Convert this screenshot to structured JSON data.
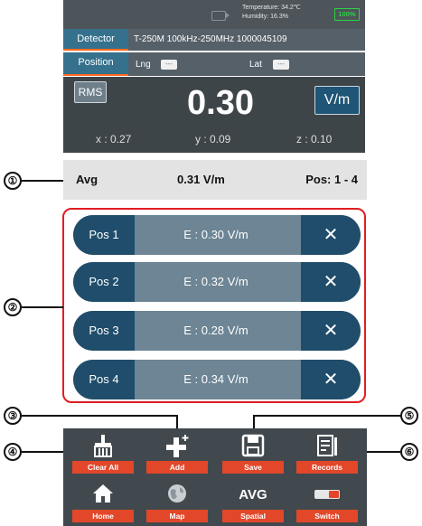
{
  "status": {
    "temperature": "Temperature: 34.2℃",
    "humidity": "Humidity: 16.3%",
    "battery": "100%"
  },
  "detector": {
    "label": "Detector",
    "value": "T-250M 100kHz-250MHz 1000045109"
  },
  "position": {
    "label": "Position",
    "lng_label": "Lng",
    "lng_value": "---",
    "lat_label": "Lat",
    "lat_value": "---"
  },
  "meter": {
    "mode": "RMS",
    "value": "0.30",
    "unit": "V/m",
    "x": "x : 0.27",
    "y": "y : 0.09",
    "z": "z : 0.10"
  },
  "average": {
    "label": "Avg",
    "value": "0.31 V/m",
    "range": "Pos: 1 - 4"
  },
  "positions": [
    {
      "name": "Pos 1",
      "value": "E :  0.30  V/m"
    },
    {
      "name": "Pos 2",
      "value": "E :  0.32  V/m"
    },
    {
      "name": "Pos 3",
      "value": "E :  0.28  V/m"
    },
    {
      "name": "Pos 4",
      "value": "E :  0.34  V/m"
    }
  ],
  "remove_glyph": "✕",
  "toolbar": [
    {
      "label": "Clear All",
      "icon": "broom-icon"
    },
    {
      "label": "Add",
      "icon": "plus-icon"
    },
    {
      "label": "Save",
      "icon": "floppy-icon"
    },
    {
      "label": "Records",
      "icon": "records-icon"
    },
    {
      "label": "Home",
      "icon": "home-icon"
    },
    {
      "label": "Map",
      "icon": "globe-icon"
    },
    {
      "label": "Spatial",
      "icon": "avg-icon",
      "icon_text": "AVG"
    },
    {
      "label": "Switch",
      "icon": "switch-icon"
    }
  ],
  "callouts": [
    "①",
    "②",
    "③",
    "④",
    "⑤",
    "⑥"
  ]
}
